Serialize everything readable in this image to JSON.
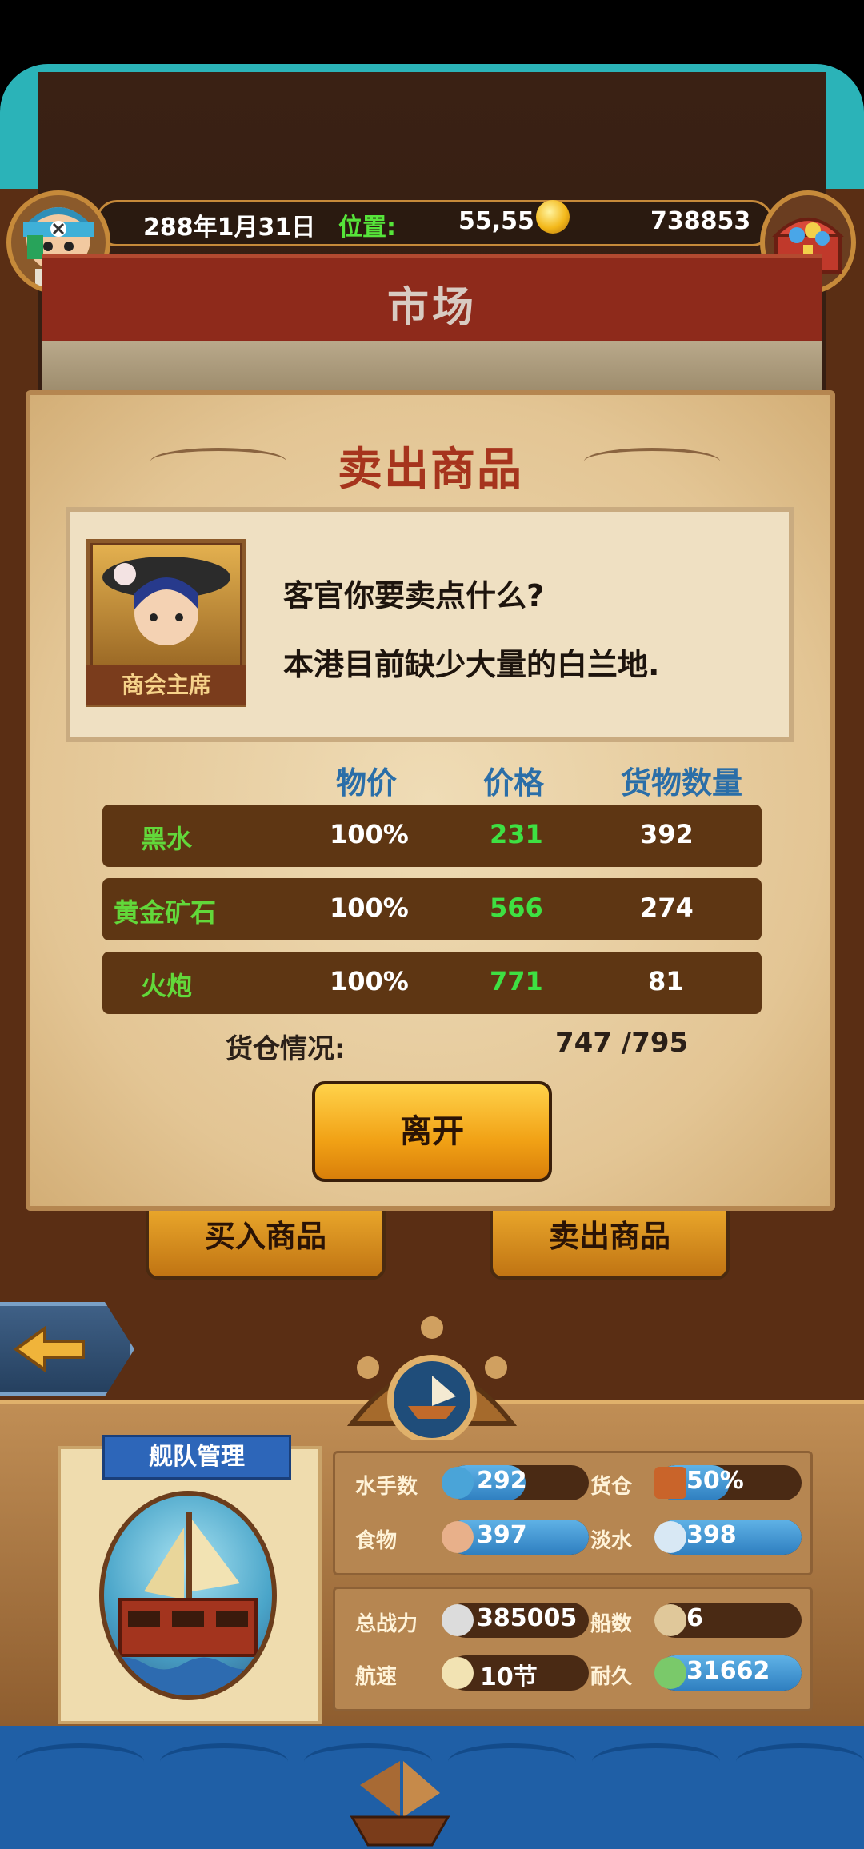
{
  "info_bar": {
    "date": "288年1月31日",
    "location_label": "位置:",
    "location_value": "55,55",
    "gold": "738853"
  },
  "market": {
    "title": "市场"
  },
  "dialog": {
    "title": "卖出商品",
    "npc_label": "商会主席",
    "line1": "客官你要卖点什么?",
    "line2": "本港目前缺少大量的白兰地."
  },
  "table": {
    "headers": {
      "ratio": "物价",
      "price": "价格",
      "quantity": "货物数量"
    },
    "rows": [
      {
        "name": "黑水",
        "ratio": "100%",
        "price": "231",
        "quantity": "392"
      },
      {
        "name": "黄金矿石",
        "ratio": "100%",
        "price": "566",
        "quantity": "274"
      },
      {
        "name": "火炮",
        "ratio": "100%",
        "price": "771",
        "quantity": "81"
      }
    ]
  },
  "hold": {
    "label": "货仓情况:",
    "value": "747 /795"
  },
  "buttons": {
    "leave": "离开",
    "buy_goods": "买入商品",
    "sell_goods": "卖出商品"
  },
  "fleet": {
    "title": "舰队管理",
    "stats": {
      "sailors": {
        "label": "水手数",
        "value": "292",
        "fill": 0.55
      },
      "cargo": {
        "label": "货仓",
        "value": "50%",
        "fill": 0.5
      },
      "food": {
        "label": "食物",
        "value": "397",
        "fill": 1.0
      },
      "water": {
        "label": "淡水",
        "value": "398",
        "fill": 1.0
      },
      "power": {
        "label": "总战力",
        "value": "385005",
        "fill": 0.0
      },
      "ships": {
        "label": "船数",
        "value": "6",
        "fill": 0.0
      },
      "speed": {
        "label": "航速",
        "value": "10节",
        "fill": 0.0
      },
      "durability": {
        "label": "耐久",
        "value": "31662",
        "fill": 1.0
      }
    }
  },
  "colors": {
    "accent_green": "#56e43a",
    "price_green": "#3ee042",
    "header_blue": "#2a6ea8",
    "title_red": "#a6341d",
    "bar_blue": "#2f7fc0"
  },
  "icons": [
    "pirate-avatar-icon",
    "gold-coin-icon",
    "treasure-chest-icon",
    "back-arrow-icon",
    "ship-wheel-icon",
    "sailor-icon",
    "cargo-icon",
    "food-icon",
    "water-icon",
    "power-icon",
    "ship-count-icon",
    "speed-icon",
    "durability-icon"
  ]
}
